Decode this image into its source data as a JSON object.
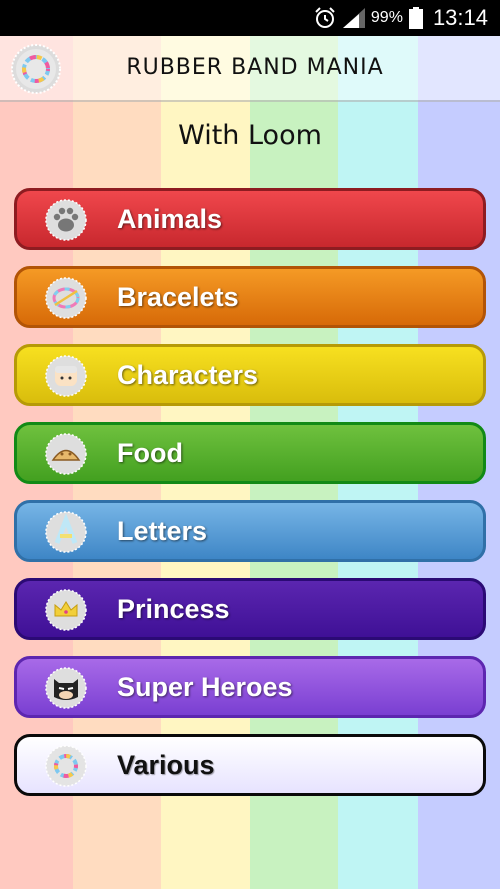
{
  "status_bar": {
    "battery_percent": "99%",
    "time": "13:14",
    "icons": [
      "alarm-icon",
      "signal-icon",
      "battery-icon"
    ]
  },
  "action_bar": {
    "title": "RUBBER BAND MANIA",
    "logo_icon": "loom-bracelet-logo-icon"
  },
  "subtitle": "With Loom",
  "menu": {
    "items": [
      {
        "label": "Animals",
        "icon": "paw-icon",
        "color": "#e03a40"
      },
      {
        "label": "Bracelets",
        "icon": "bracelet-icon",
        "color": "#ee8417"
      },
      {
        "label": "Characters",
        "icon": "character-face-icon",
        "color": "#efd21a"
      },
      {
        "label": "Food",
        "icon": "taco-icon",
        "color": "#5cb32f"
      },
      {
        "label": "Letters",
        "icon": "letter-icon",
        "color": "#5a9fd8"
      },
      {
        "label": "Princess",
        "icon": "crown-icon",
        "color": "#4d1aa3"
      },
      {
        "label": "Super Heroes",
        "icon": "masked-hero-icon",
        "color": "#9458de"
      },
      {
        "label": "Various",
        "icon": "rainbow-ring-icon",
        "color": "#f4f2ff"
      }
    ]
  },
  "background_stripes": [
    "#ffc9c0",
    "#ffdcc0",
    "#fff6c2",
    "#c8f2c0",
    "#bff5f4",
    "#c5ccff"
  ]
}
